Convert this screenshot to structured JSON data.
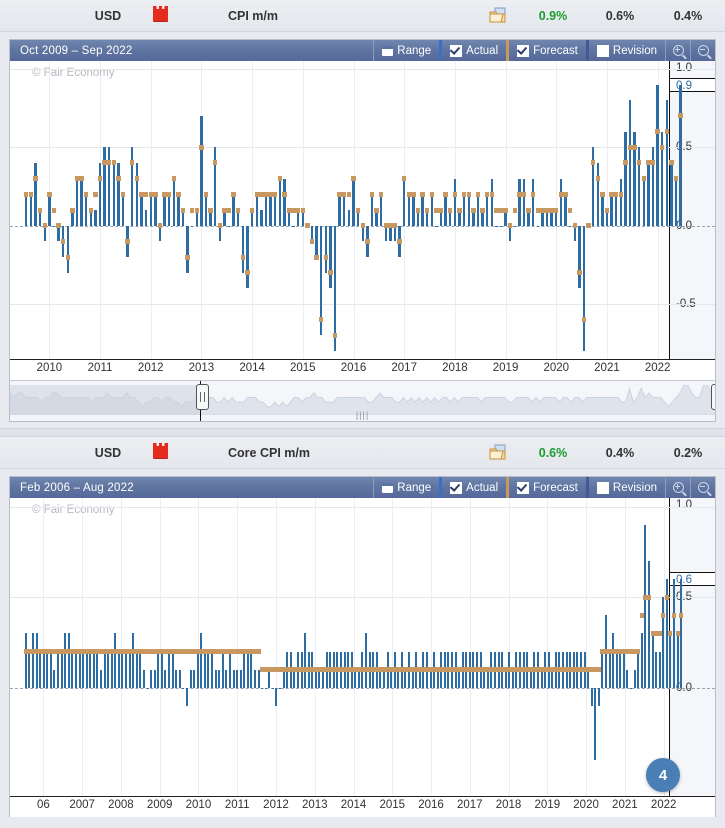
{
  "panels": [
    {
      "event": {
        "currency": "USD",
        "impact_icon": "high-impact-red-folder-icon",
        "title": "CPI m/m",
        "detail_icon": "detail-document-icon",
        "actual": "0.9%",
        "forecast": "0.6%",
        "previous": "0.4%"
      },
      "toolbar": {
        "range_text": "Oct 2009 – Sep 2022",
        "range_btn": "Range",
        "actual_btn": "Actual",
        "forecast_btn": "Forecast",
        "revision_btn": "Revision",
        "actual_checked": true,
        "forecast_checked": true,
        "revision_checked": false,
        "zoom_in_icon": "zoom-in-icon",
        "zoom_out_icon": "zoom-out-icon"
      },
      "watermark": "© Fair Economy",
      "yaxis": {
        "top": "1.0",
        "current": "0.9",
        "ticks": [
          "0.5",
          "0.0",
          "-0.5"
        ]
      },
      "xaxis": [
        "2010",
        "2011",
        "2012",
        "2013",
        "2014",
        "2015",
        "2016",
        "2017",
        "2018",
        "2019",
        "2020",
        "2021",
        "2022"
      ],
      "has_navigator": true
    },
    {
      "event": {
        "currency": "USD",
        "impact_icon": "high-impact-red-folder-icon",
        "title": "Core CPI m/m",
        "detail_icon": "detail-document-icon",
        "actual": "0.6%",
        "forecast": "0.4%",
        "previous": "0.2%"
      },
      "toolbar": {
        "range_text": "Feb 2006 – Aug 2022",
        "range_btn": "Range",
        "actual_btn": "Actual",
        "forecast_btn": "Forecast",
        "revision_btn": "Revision",
        "actual_checked": true,
        "forecast_checked": true,
        "revision_checked": false,
        "zoom_in_icon": "zoom-in-icon",
        "zoom_out_icon": "zoom-out-icon"
      },
      "watermark": "© Fair Economy",
      "yaxis": {
        "top": "1.0",
        "current": "0.6",
        "ticks": [
          "0.5",
          "0.0"
        ]
      },
      "xaxis": [
        "06",
        "2007",
        "2008",
        "2009",
        "2010",
        "2011",
        "2012",
        "2013",
        "2014",
        "2015",
        "2016",
        "2017",
        "2018",
        "2019",
        "2020",
        "2021",
        "2022"
      ],
      "has_navigator": false,
      "badge": "4"
    }
  ],
  "colors": {
    "actual_bar": "#2e6da4",
    "forecast_marker": "#c89860",
    "actual_value": "#1a9c2e",
    "titlebar": "#5e74a0",
    "impact": "#e52b1e",
    "badge": "#4a7fb5"
  },
  "chart_data": [
    {
      "type": "bar",
      "title": "CPI m/m",
      "subtitle": "Oct 2009 – Sep 2022",
      "xlabel": "",
      "ylabel": "",
      "ylim": [
        -0.85,
        1.05
      ],
      "grid": true,
      "legend": [
        "Actual",
        "Forecast"
      ],
      "legend_position": "toolbar",
      "x": [
        "2010",
        "2011",
        "2012",
        "2013",
        "2014",
        "2015",
        "2016",
        "2017",
        "2018",
        "2019",
        "2020",
        "2021",
        "2022"
      ],
      "series": [
        {
          "name": "Actual",
          "values": [
            0.2,
            0.2,
            0.4,
            0.1,
            -0.1,
            0.2,
            0.0,
            -0.1,
            -0.2,
            -0.3,
            0.1,
            0.3,
            0.3,
            0.2,
            0.1,
            0.1,
            0.4,
            0.5,
            0.5,
            0.4,
            0.4,
            0.2,
            -0.2,
            0.5,
            0.4,
            0.2,
            0.1,
            0.2,
            0.2,
            -0.1,
            0.2,
            0.2,
            0.3,
            0.2,
            0.1,
            -0.3,
            0.0,
            0.1,
            0.7,
            0.2,
            0.1,
            0.5,
            -0.1,
            0.1,
            0.0,
            0.2,
            0.1,
            -0.3,
            -0.4,
            0.1,
            0.2,
            0.1,
            0.2,
            0.2,
            0.2,
            0.3,
            0.3,
            0.1,
            0.0,
            0.1,
            0.1,
            0.0,
            -0.1,
            -0.2,
            -0.7,
            -0.3,
            -0.4,
            -0.8,
            0.2,
            0.2,
            0.1,
            0.3,
            0.1,
            -0.1,
            -0.2,
            0.2,
            0.1,
            0.2,
            -0.1,
            -0.1,
            -0.1,
            -0.2,
            0.3,
            0.2,
            0.2,
            0.1,
            0.2,
            0.1,
            0.2,
            0.0,
            0.1,
            0.2,
            0.1,
            0.3,
            0.1,
            0.2,
            0.2,
            0.1,
            0.2,
            0.1,
            0.2,
            0.3,
            0.0,
            0.0,
            0.1,
            -0.1,
            0.0,
            0.3,
            0.3,
            0.1,
            0.3,
            0.0,
            0.1,
            0.1,
            0.1,
            0.1,
            0.3,
            0.2,
            0.0,
            -0.1,
            -0.4,
            -0.8,
            0.0,
            0.5,
            0.4,
            0.2,
            0.1,
            0.2,
            0.2,
            0.3,
            0.6,
            0.8,
            0.6,
            0.5,
            0.3,
            0.4,
            0.5,
            0.9,
            0.6,
            0.8,
            0.4,
            0.3,
            0.9
          ]
        },
        {
          "name": "Forecast",
          "values": [
            0.2,
            0.2,
            0.3,
            0.1,
            0.0,
            0.2,
            0.1,
            0.0,
            -0.1,
            -0.2,
            0.1,
            0.3,
            0.3,
            0.2,
            0.1,
            0.2,
            0.3,
            0.4,
            0.4,
            0.4,
            0.3,
            0.2,
            -0.1,
            0.4,
            0.3,
            0.2,
            0.2,
            0.2,
            0.2,
            0.0,
            0.2,
            0.2,
            0.3,
            0.2,
            0.1,
            -0.2,
            0.1,
            0.1,
            0.5,
            0.2,
            0.1,
            0.4,
            0.0,
            0.1,
            0.1,
            0.2,
            0.1,
            -0.2,
            -0.3,
            0.1,
            0.2,
            0.2,
            0.2,
            0.2,
            0.2,
            0.3,
            0.2,
            0.1,
            0.1,
            0.1,
            0.1,
            0.0,
            -0.1,
            -0.2,
            -0.6,
            -0.2,
            -0.3,
            -0.7,
            0.2,
            0.2,
            0.2,
            0.3,
            0.1,
            0.0,
            -0.1,
            0.2,
            0.1,
            0.2,
            0.0,
            0.0,
            0.0,
            -0.1,
            0.3,
            0.2,
            0.2,
            0.1,
            0.2,
            0.1,
            0.2,
            0.1,
            0.1,
            0.2,
            0.1,
            0.2,
            0.1,
            0.2,
            0.2,
            0.1,
            0.2,
            0.1,
            0.2,
            0.2,
            0.1,
            0.1,
            0.1,
            0.0,
            0.1,
            0.2,
            0.2,
            0.1,
            0.2,
            0.1,
            0.1,
            0.1,
            0.1,
            0.1,
            0.2,
            0.2,
            0.1,
            0.0,
            -0.3,
            -0.6,
            0.0,
            0.4,
            0.3,
            0.2,
            0.1,
            0.2,
            0.2,
            0.2,
            0.4,
            0.5,
            0.5,
            0.4,
            0.3,
            0.4,
            0.4,
            0.6,
            0.5,
            0.6,
            0.4,
            0.3,
            0.7
          ]
        }
      ]
    },
    {
      "type": "bar",
      "title": "Core CPI m/m",
      "subtitle": "Feb 2006 – Aug 2022",
      "xlabel": "",
      "ylabel": "",
      "ylim": [
        -0.6,
        1.05
      ],
      "grid": true,
      "legend": [
        "Actual",
        "Forecast"
      ],
      "legend_position": "toolbar",
      "x": [
        "06",
        "2007",
        "2008",
        "2009",
        "2010",
        "2011",
        "2012",
        "2013",
        "2014",
        "2015",
        "2016",
        "2017",
        "2018",
        "2019",
        "2020",
        "2021",
        "2022"
      ],
      "series": [
        {
          "name": "Actual",
          "values": [
            0.3,
            0.2,
            0.3,
            0.3,
            0.2,
            0.2,
            0.2,
            0.2,
            0.1,
            0.2,
            0.2,
            0.3,
            0.3,
            0.2,
            0.2,
            0.2,
            0.2,
            0.2,
            0.2,
            0.2,
            0.2,
            0.1,
            0.2,
            0.2,
            0.2,
            0.3,
            0.2,
            0.2,
            0.2,
            0.2,
            0.3,
            0.2,
            0.2,
            0.1,
            0.0,
            0.1,
            0.1,
            0.2,
            0.2,
            0.1,
            0.2,
            0.2,
            0.1,
            0.1,
            0.0,
            -0.1,
            0.1,
            0.1,
            0.2,
            0.3,
            0.2,
            0.2,
            0.2,
            0.1,
            0.1,
            0.2,
            0.1,
            0.2,
            0.1,
            0.1,
            0.1,
            0.2,
            0.2,
            0.2,
            0.1,
            0.1,
            0.0,
            0.0,
            0.1,
            0.0,
            -0.1,
            0.0,
            0.1,
            0.2,
            0.2,
            0.1,
            0.2,
            0.2,
            0.3,
            0.2,
            0.2,
            0.1,
            0.1,
            0.1,
            0.2,
            0.2,
            0.2,
            0.2,
            0.2,
            0.2,
            0.2,
            0.2,
            0.1,
            0.1,
            0.2,
            0.3,
            0.2,
            0.2,
            0.2,
            0.1,
            0.1,
            0.2,
            0.1,
            0.2,
            0.1,
            0.2,
            0.1,
            0.2,
            0.1,
            0.2,
            0.1,
            0.2,
            0.2,
            0.1,
            0.2,
            0.1,
            0.2,
            0.2,
            0.2,
            0.2,
            0.2,
            0.1,
            0.2,
            0.2,
            0.2,
            0.2,
            0.2,
            0.2,
            0.1,
            0.1,
            0.2,
            0.2,
            0.2,
            0.2,
            0.1,
            0.2,
            0.1,
            0.2,
            0.2,
            0.2,
            0.2,
            0.1,
            0.2,
            0.2,
            0.1,
            0.2,
            0.2,
            0.1,
            0.2,
            0.2,
            0.2,
            0.2,
            0.2,
            0.2,
            0.2,
            0.2,
            0.2,
            0.1,
            -0.1,
            -0.4,
            -0.1,
            0.2,
            0.4,
            0.2,
            0.3,
            0.2,
            0.2,
            0.2,
            0.1,
            0.0,
            0.1,
            0.2,
            0.3,
            0.9,
            0.7,
            0.3,
            0.2,
            0.2,
            0.5,
            0.6,
            0.3,
            0.6,
            0.3,
            0.6
          ]
        },
        {
          "name": "Forecast",
          "values": [
            0.2,
            0.2,
            0.2,
            0.2,
            0.2,
            0.2,
            0.2,
            0.2,
            0.2,
            0.2,
            0.2,
            0.2,
            0.2,
            0.2,
            0.2,
            0.2,
            0.2,
            0.2,
            0.2,
            0.2,
            0.2,
            0.2,
            0.2,
            0.2,
            0.2,
            0.2,
            0.2,
            0.2,
            0.2,
            0.2,
            0.2,
            0.2,
            0.2,
            0.2,
            0.2,
            0.2,
            0.2,
            0.2,
            0.2,
            0.2,
            0.2,
            0.2,
            0.2,
            0.2,
            0.2,
            0.2,
            0.2,
            0.2,
            0.2,
            0.2,
            0.2,
            0.2,
            0.2,
            0.2,
            0.2,
            0.2,
            0.2,
            0.2,
            0.2,
            0.2,
            0.2,
            0.2,
            0.2,
            0.2,
            0.2,
            0.2,
            0.1,
            0.1,
            0.1,
            0.1,
            0.1,
            0.1,
            0.1,
            0.1,
            0.1,
            0.1,
            0.1,
            0.1,
            0.1,
            0.1,
            0.1,
            0.1,
            0.1,
            0.1,
            0.1,
            0.1,
            0.1,
            0.1,
            0.1,
            0.1,
            0.1,
            0.1,
            0.1,
            0.1,
            0.1,
            0.1,
            0.1,
            0.1,
            0.1,
            0.1,
            0.1,
            0.1,
            0.1,
            0.1,
            0.1,
            0.1,
            0.1,
            0.1,
            0.1,
            0.1,
            0.1,
            0.1,
            0.1,
            0.1,
            0.1,
            0.1,
            0.1,
            0.1,
            0.1,
            0.1,
            0.1,
            0.1,
            0.1,
            0.1,
            0.1,
            0.1,
            0.1,
            0.1,
            0.1,
            0.1,
            0.1,
            0.1,
            0.1,
            0.1,
            0.1,
            0.1,
            0.1,
            0.1,
            0.1,
            0.1,
            0.1,
            0.1,
            0.1,
            0.1,
            0.1,
            0.1,
            0.1,
            0.1,
            0.1,
            0.1,
            0.1,
            0.1,
            0.1,
            0.1,
            0.1,
            0.1,
            0.1,
            0.1,
            0.1,
            0.1,
            0.1,
            0.2,
            0.2,
            0.2,
            0.2,
            0.2,
            0.2,
            0.2,
            0.2,
            0.2,
            0.2,
            0.2,
            0.4,
            0.5,
            0.5,
            0.3,
            0.3,
            0.3,
            0.4,
            0.5,
            0.3,
            0.4,
            0.3,
            0.4
          ]
        }
      ]
    }
  ]
}
